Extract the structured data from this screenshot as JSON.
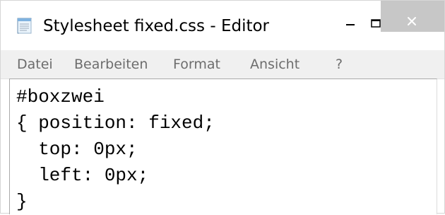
{
  "window": {
    "title": "Stylesheet fixed.css - Editor",
    "icon": "notepad-icon",
    "controls": {
      "minimize": "minimize-icon",
      "maximize": "maximize-icon",
      "close": "close-icon"
    }
  },
  "menubar": {
    "items": [
      "Datei",
      "Bearbeiten",
      "Format",
      "Ansicht",
      "?"
    ]
  },
  "editor": {
    "lines": [
      "#boxzwei",
      "{ position: fixed;",
      "  top: 0px;",
      "  left: 0px;",
      "}"
    ]
  },
  "colors": {
    "menubar_background": "#f0f0f0",
    "menu_text": "#6d6d6d",
    "close_button_background": "#c7c7c7"
  }
}
